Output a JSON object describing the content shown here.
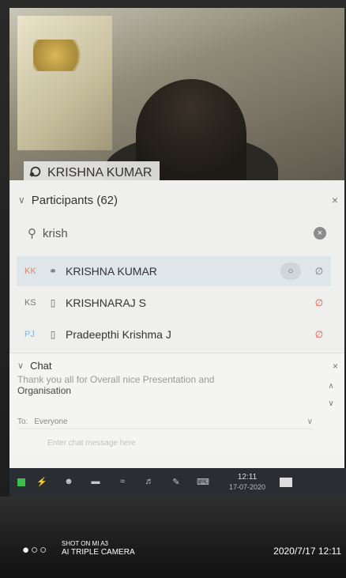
{
  "video": {
    "speaker_name": "KRISHNA KUMAR",
    "speaker_icon": "audio-icon"
  },
  "participants": {
    "title": "Participants (62)",
    "search_value": "krish",
    "rows": [
      {
        "initials": "KK",
        "name": "KRISHNA KUMAR",
        "device_icon": "audio-icon",
        "has_chat": true,
        "mic_state": "muted"
      },
      {
        "initials": "KS",
        "name": "KRISHNARAJ S",
        "device_icon": "desktop-icon",
        "has_chat": false,
        "mic_state": "muted-red"
      },
      {
        "initials": "PJ",
        "name": "Pradeepthi Krishma J",
        "device_icon": "desktop-icon",
        "has_chat": false,
        "mic_state": "muted-red"
      }
    ]
  },
  "chat": {
    "title": "Chat",
    "message_line1": "Thank you all for Overall nice Presentation and",
    "message_line2": "Organisation",
    "to_label": "To:",
    "to_value": "Everyone",
    "input_placeholder": "Enter chat message here"
  },
  "taskbar": {
    "time": "12:11",
    "date": "17-07-2020"
  },
  "camera": {
    "line1": "SHOT ON MI A3",
    "line2": "AI TRIPLE CAMERA",
    "timestamp": "2020/7/17  12:11"
  },
  "colors": {
    "selected_row": "#dfe6ea",
    "mic_red": "#e05a4b",
    "taskbar": "#2a2e33"
  }
}
